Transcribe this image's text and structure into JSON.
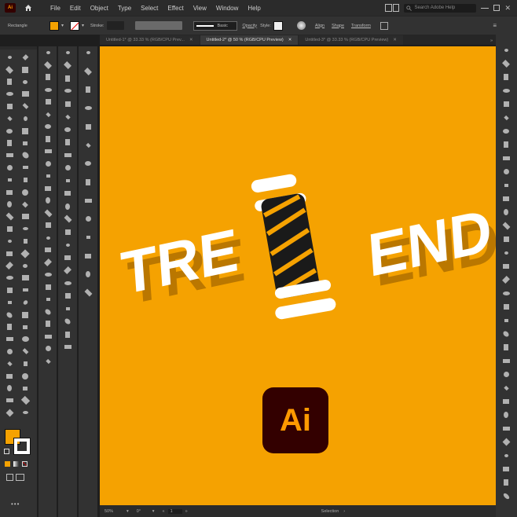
{
  "app": {
    "logo_text": "Ai"
  },
  "menu": [
    "File",
    "Edit",
    "Object",
    "Type",
    "Select",
    "Effect",
    "View",
    "Window",
    "Help"
  ],
  "search": {
    "placeholder": "Search Adobe Help"
  },
  "control": {
    "tool_name": "Rectangle",
    "stroke_label": "Stroke:",
    "brush_label": "Basic",
    "opacity_label": "Opacity",
    "style_label": "Style:",
    "align_label": "Align",
    "shape_label": "Shape",
    "transform_label": "Transform",
    "fill_color": "#f5a201"
  },
  "tabs": [
    {
      "label": "Untitled-1* @ 33.33 % (RGB/CPU Prev...",
      "active": false
    },
    {
      "label": "Untitled-2* @ 50 % (RGB/CPU Preview)",
      "active": true
    },
    {
      "label": "Untitled-3* @ 33.33 % (RGB/CPU Preview)",
      "active": false
    }
  ],
  "artboard": {
    "text_left": "TRE",
    "text_right": "END",
    "badge_text": "Ai",
    "bg_color": "#f5a201"
  },
  "status": {
    "zoom": "50%",
    "rotation": "0°",
    "artboard": "1",
    "tool": "Selection"
  }
}
